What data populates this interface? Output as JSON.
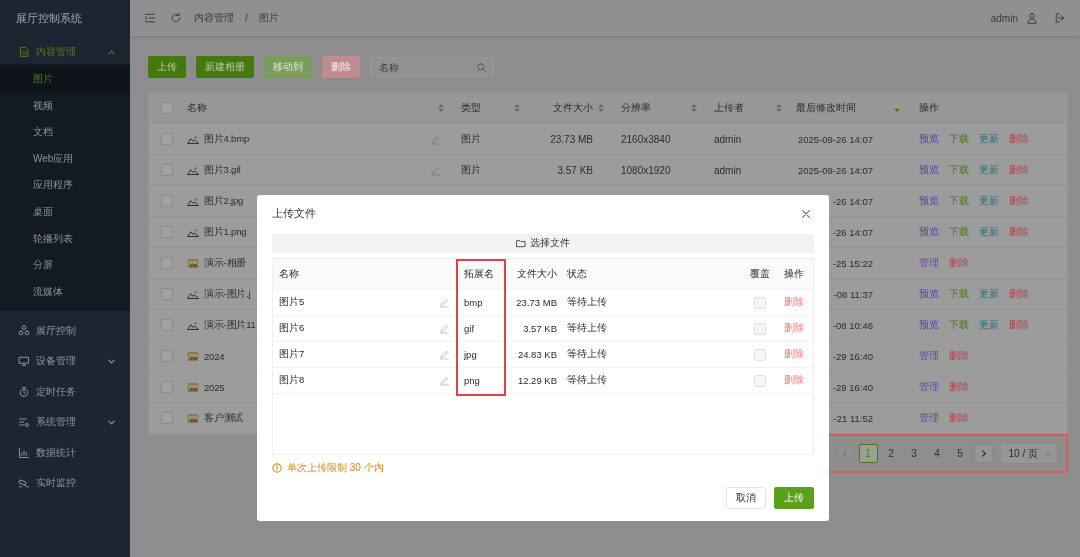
{
  "sidebar": {
    "title": "展厅控制系统",
    "items": [
      {
        "label": "内容管理",
        "expanded": true,
        "children": [
          {
            "label": "图片",
            "selected": true
          },
          {
            "label": "视频",
            "selected": false
          },
          {
            "label": "文档",
            "selected": false
          },
          {
            "label": "Web应用",
            "selected": false
          },
          {
            "label": "应用程序",
            "selected": false
          },
          {
            "label": "桌面",
            "selected": false
          },
          {
            "label": "轮播列表",
            "selected": false
          },
          {
            "label": "分屏",
            "selected": false
          },
          {
            "label": "流媒体",
            "selected": false
          }
        ]
      },
      {
        "label": "展厅控制"
      },
      {
        "label": "设备管理",
        "expanded": false
      },
      {
        "label": "定时任务"
      },
      {
        "label": "系统管理",
        "expanded": false
      },
      {
        "label": "数据统计"
      },
      {
        "label": "实时监控"
      }
    ]
  },
  "header": {
    "breadcrumb": [
      "内容管理",
      "图片"
    ],
    "separator": "/",
    "user": "admin"
  },
  "toolbar": {
    "buttons": [
      {
        "label": "上传",
        "kind": "primary",
        "disabled": false
      },
      {
        "label": "新建相册",
        "kind": "primary",
        "disabled": false
      },
      {
        "label": "移动到",
        "kind": "primary",
        "disabled": true
      },
      {
        "label": "删除",
        "kind": "danger",
        "disabled": true
      }
    ],
    "search": {
      "placeholder": "名称"
    }
  },
  "table": {
    "all_checked": false,
    "columns": [
      {
        "label": "名称",
        "sorted": false
      },
      {
        "label": "类型",
        "sorted": false
      },
      {
        "label": "文件大小",
        "sorted": false
      },
      {
        "label": "分辨率",
        "sorted": false
      },
      {
        "label": "上传者",
        "sorted": false
      },
      {
        "label": "最后修改时间",
        "sorted": true
      },
      {
        "label": "操作"
      }
    ],
    "rows": [
      {
        "kind": "image",
        "checked": false,
        "name": "图片4.bmp",
        "type": "图片",
        "size": "23.73 MB",
        "resolution": "2160x3840",
        "uploader": "admin",
        "modified": "2025-09-26 14:07",
        "actions": [
          {
            "label": "预览",
            "kind": "preview"
          },
          {
            "label": "下载",
            "kind": "download"
          },
          {
            "label": "更新",
            "kind": "update"
          },
          {
            "label": "删除",
            "kind": "delete"
          }
        ]
      },
      {
        "kind": "image",
        "checked": false,
        "name": "图片3.gif",
        "type": "图片",
        "size": "3.57 KB",
        "resolution": "1080x1920",
        "uploader": "admin",
        "modified": "2025-09-26 14:07",
        "actions": [
          {
            "label": "预览",
            "kind": "preview"
          },
          {
            "label": "下载",
            "kind": "download"
          },
          {
            "label": "更新",
            "kind": "update"
          },
          {
            "label": "删除",
            "kind": "delete"
          }
        ]
      },
      {
        "kind": "image",
        "checked": false,
        "name": "图片2.jpg",
        "modified": "-26 14:07",
        "actions": [
          {
            "label": "预览",
            "kind": "preview"
          },
          {
            "label": "下载",
            "kind": "download"
          },
          {
            "label": "更新",
            "kind": "update"
          },
          {
            "label": "删除",
            "kind": "delete"
          }
        ]
      },
      {
        "kind": "image",
        "checked": false,
        "name": "图片1.png",
        "modified": "-26 14:07",
        "actions": [
          {
            "label": "预览",
            "kind": "preview"
          },
          {
            "label": "下载",
            "kind": "download"
          },
          {
            "label": "更新",
            "kind": "update"
          },
          {
            "label": "删除",
            "kind": "delete"
          }
        ]
      },
      {
        "kind": "album",
        "checked": false,
        "name": "演示-相册",
        "modified": "-25 15:22",
        "actions": [
          {
            "label": "管理",
            "kind": "manage"
          },
          {
            "label": "删除",
            "kind": "delete"
          }
        ]
      },
      {
        "kind": "image",
        "checked": false,
        "name": "演示-图片.j",
        "modified": "-08 11:37",
        "actions": [
          {
            "label": "预览",
            "kind": "preview"
          },
          {
            "label": "下载",
            "kind": "download"
          },
          {
            "label": "更新",
            "kind": "update"
          },
          {
            "label": "删除",
            "kind": "delete"
          }
        ]
      },
      {
        "kind": "image",
        "checked": false,
        "name": "演示-图片11",
        "modified": "-08 10:46",
        "actions": [
          {
            "label": "预览",
            "kind": "preview"
          },
          {
            "label": "下载",
            "kind": "download"
          },
          {
            "label": "更新",
            "kind": "update"
          },
          {
            "label": "删除",
            "kind": "delete"
          }
        ]
      },
      {
        "kind": "album",
        "checked": false,
        "name": "2024",
        "modified": "-29 16:40",
        "actions": [
          {
            "label": "管理",
            "kind": "manage"
          },
          {
            "label": "删除",
            "kind": "delete"
          }
        ]
      },
      {
        "kind": "album",
        "checked": false,
        "name": "2025",
        "modified": "-29 16:40",
        "actions": [
          {
            "label": "管理",
            "kind": "manage"
          },
          {
            "label": "删除",
            "kind": "delete"
          }
        ]
      },
      {
        "kind": "album",
        "checked": false,
        "name": "客户测试",
        "modified": "-21 11:52",
        "actions": [
          {
            "label": "管理",
            "kind": "manage"
          },
          {
            "label": "删除",
            "kind": "delete"
          }
        ]
      }
    ]
  },
  "pagination": {
    "highlighted": true,
    "prev_disabled": true,
    "next_disabled": false,
    "pages": [
      {
        "label": "1",
        "selected": true
      },
      {
        "label": "2",
        "selected": false
      },
      {
        "label": "3",
        "selected": false
      },
      {
        "label": "4",
        "selected": false
      },
      {
        "label": "5",
        "selected": false
      }
    ],
    "page_size": "10 / 页"
  },
  "upload_dialog": {
    "title": "上传文件",
    "choose_button": "选择文件",
    "columns": [
      {
        "label": "名称",
        "highlighted": false
      },
      {
        "label": "拓展名",
        "highlighted": true
      },
      {
        "label": "文件大小",
        "highlighted": false
      },
      {
        "label": "状态",
        "highlighted": false
      },
      {
        "label": "覆盖",
        "highlighted": false
      },
      {
        "label": "操作",
        "highlighted": false
      }
    ],
    "rows": [
      {
        "name": "图片5",
        "ext": "bmp",
        "size": "23.73 MB",
        "status": "等待上传",
        "overwrite": false,
        "action": "删除"
      },
      {
        "name": "图片6",
        "ext": "gif",
        "size": "3.57 KB",
        "status": "等待上传",
        "overwrite": false,
        "action": "删除"
      },
      {
        "name": "图片7",
        "ext": "jpg",
        "size": "24.83 KB",
        "status": "等待上传",
        "overwrite": false,
        "action": "删除"
      },
      {
        "name": "图片8",
        "ext": "png",
        "size": "12.29 KB",
        "status": "等待上传",
        "overwrite": false,
        "action": "删除"
      }
    ],
    "hint": "单次上传限制 30 个内",
    "buttons": [
      {
        "label": "取消",
        "kind": "default"
      },
      {
        "label": "上传",
        "kind": "primary"
      }
    ]
  }
}
